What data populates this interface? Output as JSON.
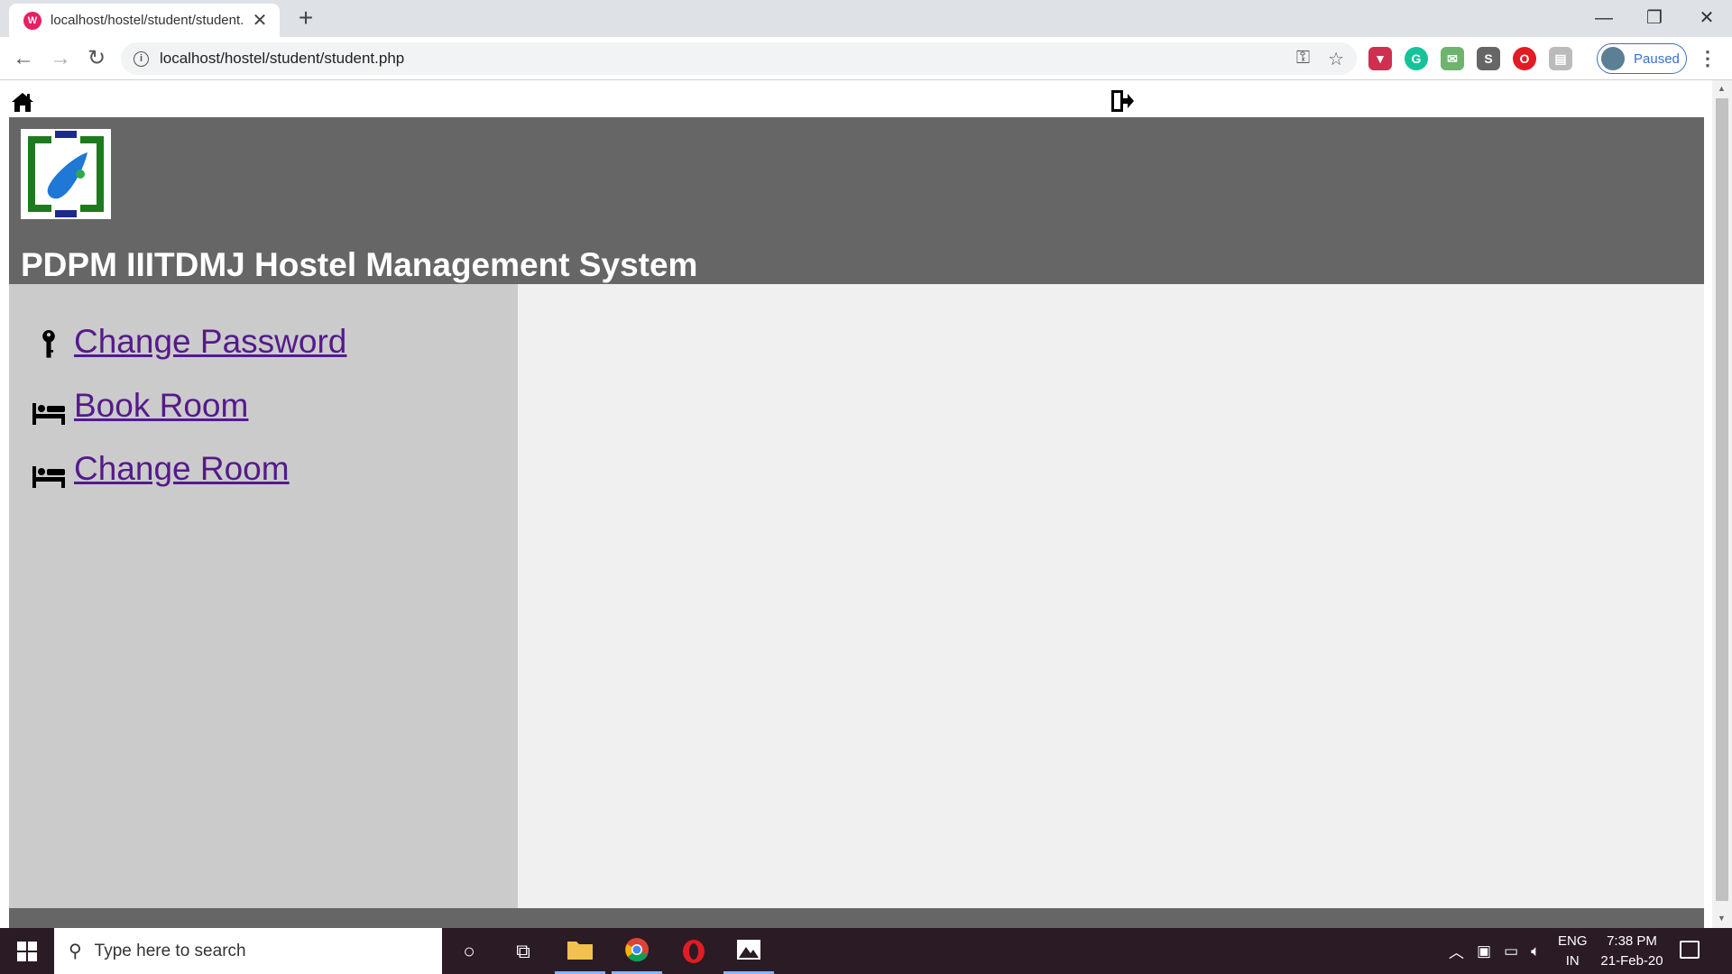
{
  "browser": {
    "tab_title": "localhost/hostel/student/student.php",
    "tab_favicon": "wamp-icon",
    "url": "localhost/hostel/student/student.php",
    "profile_label": "Paused",
    "extensions": [
      "pocket-icon",
      "grammarly-icon",
      "mail-icon",
      "s-icon",
      "opera-icon",
      "docs-icon"
    ]
  },
  "nav": {
    "home_icon": "home-icon",
    "logout_icon": "logout-icon"
  },
  "header": {
    "title": "PDPM IIITDMJ Hostel Management System"
  },
  "sidebar": {
    "items": [
      {
        "label": "Change Password",
        "icon": "key-icon"
      },
      {
        "label": "Book Room",
        "icon": "bed-icon"
      },
      {
        "label": "Change Room",
        "icon": "bed-icon"
      }
    ]
  },
  "taskbar": {
    "search_placeholder": "Type here to search",
    "lang_line1": "ENG",
    "lang_line2": "IN",
    "time": "7:38 PM",
    "date": "21-Feb-20"
  },
  "colors": {
    "header_bg": "#666666",
    "sidebar_bg": "#cbcbcb",
    "content_bg": "#f0f0f0",
    "link": "#551a8b"
  }
}
